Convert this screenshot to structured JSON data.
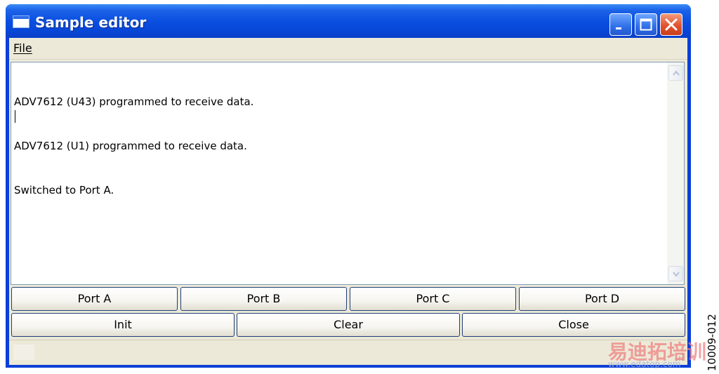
{
  "window": {
    "title": "Sample editor",
    "accent_color": "#0a3fd9",
    "icons": {
      "app": "window-icon",
      "minimize": "minimize-icon",
      "maximize": "maximize-icon",
      "close": "close-icon"
    }
  },
  "menu": {
    "items": [
      {
        "label": "File"
      }
    ]
  },
  "log": {
    "lines": [
      "ADV7612 (U43) programmed to receive data.",
      "ADV7612 (U1) programmed to receive data.",
      "Switched to Port A."
    ]
  },
  "ports": {
    "buttons": [
      {
        "label": "Port A"
      },
      {
        "label": "Port B"
      },
      {
        "label": "Port C"
      },
      {
        "label": "Port D"
      }
    ]
  },
  "actions": {
    "buttons": [
      {
        "label": "Init"
      },
      {
        "label": "Clear"
      },
      {
        "label": "Close"
      }
    ]
  },
  "figure": {
    "code": "10009-012"
  },
  "watermark": {
    "text": "易迪拓培训",
    "url": "www.edatop.com"
  }
}
